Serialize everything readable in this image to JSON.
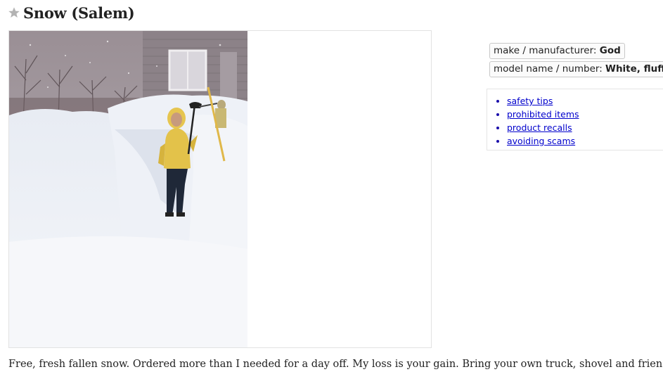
{
  "posting": {
    "title": "Snow (Salem)",
    "star_icon": "star-icon"
  },
  "gallery": {
    "image_alt": "Person in yellow coat holding a shovel standing in a path dug through deep snow"
  },
  "attributes": {
    "make_label": "make / manufacturer: ",
    "make_value": "God",
    "model_label": "model name / number: ",
    "model_value": "White, fluffy"
  },
  "safety_links": [
    "safety tips",
    "prohibited items",
    "product recalls",
    "avoiding scams"
  ],
  "description": "Free, fresh fallen snow. Ordered more than I needed for a day off. My loss is your gain. Bring your own truck, shovel and friends."
}
